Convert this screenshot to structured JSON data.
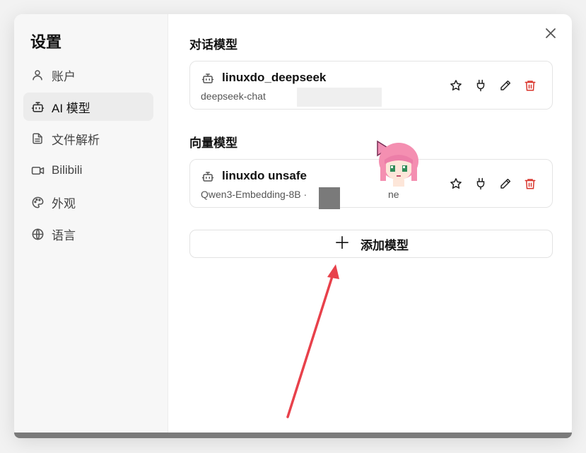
{
  "sidebar": {
    "title": "设置",
    "items": [
      {
        "label": "账户",
        "icon": "user-icon",
        "active": false
      },
      {
        "label": "AI 模型",
        "icon": "bot-icon",
        "active": true
      },
      {
        "label": "文件解析",
        "icon": "file-icon",
        "active": false
      },
      {
        "label": "Bilibili",
        "icon": "video-icon",
        "active": false
      },
      {
        "label": "外观",
        "icon": "palette-icon",
        "active": false
      },
      {
        "label": "语言",
        "icon": "globe-icon",
        "active": false
      }
    ]
  },
  "main": {
    "chat_section_title": "对话模型",
    "chat_model": {
      "name": "linuxdo_deepseek",
      "sub": "deepseek-chat"
    },
    "embedding_section_title": "向量模型",
    "embedding_model": {
      "name": "linuxdo unsafe",
      "sub": "Qwen3-Embedding-8B ·",
      "sub_tail": "ne"
    },
    "add_button_label": "添加模型",
    "add_button_icon": "plus-icon"
  },
  "colors": {
    "accent_delete": "#d9342b",
    "annotation_arrow": "#e8414b"
  }
}
